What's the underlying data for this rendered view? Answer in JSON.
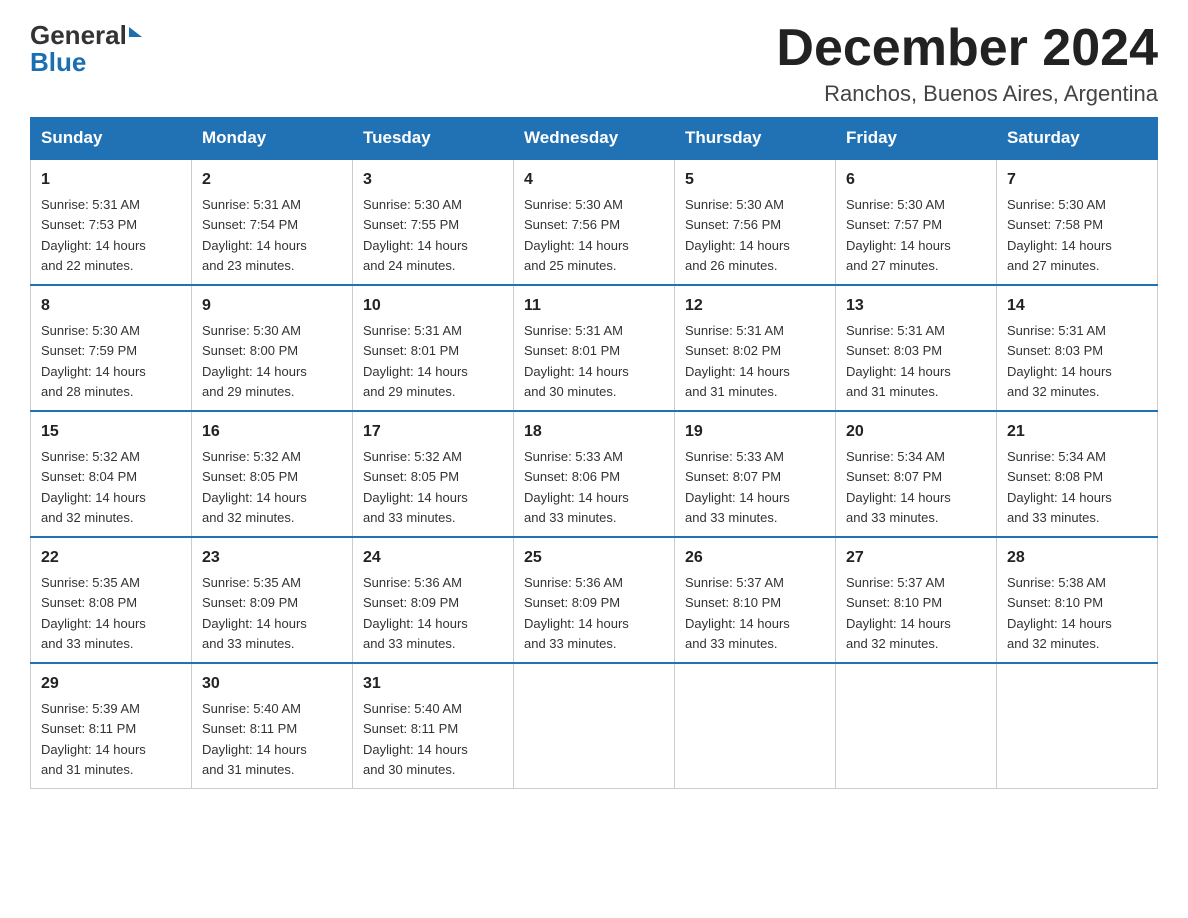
{
  "header": {
    "logo_general": "General",
    "logo_blue": "Blue",
    "month_year": "December 2024",
    "location": "Ranchos, Buenos Aires, Argentina"
  },
  "weekdays": [
    "Sunday",
    "Monday",
    "Tuesday",
    "Wednesday",
    "Thursday",
    "Friday",
    "Saturday"
  ],
  "weeks": [
    [
      {
        "day": "1",
        "sunrise": "5:31 AM",
        "sunset": "7:53 PM",
        "daylight": "14 hours and 22 minutes."
      },
      {
        "day": "2",
        "sunrise": "5:31 AM",
        "sunset": "7:54 PM",
        "daylight": "14 hours and 23 minutes."
      },
      {
        "day": "3",
        "sunrise": "5:30 AM",
        "sunset": "7:55 PM",
        "daylight": "14 hours and 24 minutes."
      },
      {
        "day": "4",
        "sunrise": "5:30 AM",
        "sunset": "7:56 PM",
        "daylight": "14 hours and 25 minutes."
      },
      {
        "day": "5",
        "sunrise": "5:30 AM",
        "sunset": "7:56 PM",
        "daylight": "14 hours and 26 minutes."
      },
      {
        "day": "6",
        "sunrise": "5:30 AM",
        "sunset": "7:57 PM",
        "daylight": "14 hours and 27 minutes."
      },
      {
        "day": "7",
        "sunrise": "5:30 AM",
        "sunset": "7:58 PM",
        "daylight": "14 hours and 27 minutes."
      }
    ],
    [
      {
        "day": "8",
        "sunrise": "5:30 AM",
        "sunset": "7:59 PM",
        "daylight": "14 hours and 28 minutes."
      },
      {
        "day": "9",
        "sunrise": "5:30 AM",
        "sunset": "8:00 PM",
        "daylight": "14 hours and 29 minutes."
      },
      {
        "day": "10",
        "sunrise": "5:31 AM",
        "sunset": "8:01 PM",
        "daylight": "14 hours and 29 minutes."
      },
      {
        "day": "11",
        "sunrise": "5:31 AM",
        "sunset": "8:01 PM",
        "daylight": "14 hours and 30 minutes."
      },
      {
        "day": "12",
        "sunrise": "5:31 AM",
        "sunset": "8:02 PM",
        "daylight": "14 hours and 31 minutes."
      },
      {
        "day": "13",
        "sunrise": "5:31 AM",
        "sunset": "8:03 PM",
        "daylight": "14 hours and 31 minutes."
      },
      {
        "day": "14",
        "sunrise": "5:31 AM",
        "sunset": "8:03 PM",
        "daylight": "14 hours and 32 minutes."
      }
    ],
    [
      {
        "day": "15",
        "sunrise": "5:32 AM",
        "sunset": "8:04 PM",
        "daylight": "14 hours and 32 minutes."
      },
      {
        "day": "16",
        "sunrise": "5:32 AM",
        "sunset": "8:05 PM",
        "daylight": "14 hours and 32 minutes."
      },
      {
        "day": "17",
        "sunrise": "5:32 AM",
        "sunset": "8:05 PM",
        "daylight": "14 hours and 33 minutes."
      },
      {
        "day": "18",
        "sunrise": "5:33 AM",
        "sunset": "8:06 PM",
        "daylight": "14 hours and 33 minutes."
      },
      {
        "day": "19",
        "sunrise": "5:33 AM",
        "sunset": "8:07 PM",
        "daylight": "14 hours and 33 minutes."
      },
      {
        "day": "20",
        "sunrise": "5:34 AM",
        "sunset": "8:07 PM",
        "daylight": "14 hours and 33 minutes."
      },
      {
        "day": "21",
        "sunrise": "5:34 AM",
        "sunset": "8:08 PM",
        "daylight": "14 hours and 33 minutes."
      }
    ],
    [
      {
        "day": "22",
        "sunrise": "5:35 AM",
        "sunset": "8:08 PM",
        "daylight": "14 hours and 33 minutes."
      },
      {
        "day": "23",
        "sunrise": "5:35 AM",
        "sunset": "8:09 PM",
        "daylight": "14 hours and 33 minutes."
      },
      {
        "day": "24",
        "sunrise": "5:36 AM",
        "sunset": "8:09 PM",
        "daylight": "14 hours and 33 minutes."
      },
      {
        "day": "25",
        "sunrise": "5:36 AM",
        "sunset": "8:09 PM",
        "daylight": "14 hours and 33 minutes."
      },
      {
        "day": "26",
        "sunrise": "5:37 AM",
        "sunset": "8:10 PM",
        "daylight": "14 hours and 33 minutes."
      },
      {
        "day": "27",
        "sunrise": "5:37 AM",
        "sunset": "8:10 PM",
        "daylight": "14 hours and 32 minutes."
      },
      {
        "day": "28",
        "sunrise": "5:38 AM",
        "sunset": "8:10 PM",
        "daylight": "14 hours and 32 minutes."
      }
    ],
    [
      {
        "day": "29",
        "sunrise": "5:39 AM",
        "sunset": "8:11 PM",
        "daylight": "14 hours and 31 minutes."
      },
      {
        "day": "30",
        "sunrise": "5:40 AM",
        "sunset": "8:11 PM",
        "daylight": "14 hours and 31 minutes."
      },
      {
        "day": "31",
        "sunrise": "5:40 AM",
        "sunset": "8:11 PM",
        "daylight": "14 hours and 30 minutes."
      },
      null,
      null,
      null,
      null
    ]
  ],
  "labels": {
    "sunrise": "Sunrise:",
    "sunset": "Sunset:",
    "daylight": "Daylight:"
  }
}
